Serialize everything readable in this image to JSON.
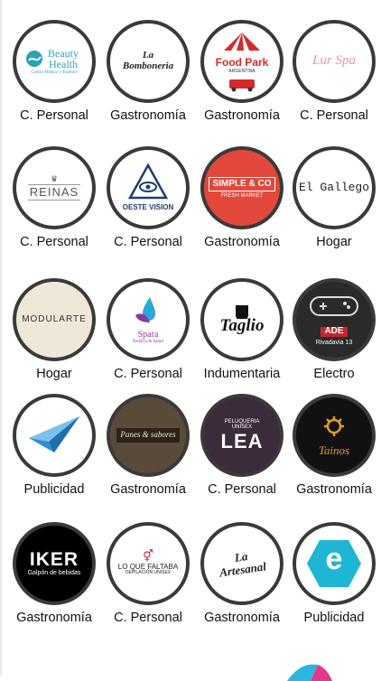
{
  "grid": {
    "rows": [
      [
        {
          "logo_text": "Beauty Health",
          "logo_sub": "Centro Médico y Estético",
          "category": "C. Personal",
          "icon": "beauty-health-logo",
          "accent": "#2aa3b6"
        },
        {
          "logo_text": "La Bomboneria",
          "logo_sub": "",
          "category": "Gastronomía",
          "icon": "la-bomboneria-logo",
          "accent": "#111111"
        },
        {
          "logo_text": "Food Park",
          "logo_sub": "ARGENTINA",
          "category": "Gastronomía",
          "icon": "food-park-logo",
          "accent": "#d42a2a"
        },
        {
          "logo_text": "Lur Spa",
          "logo_sub": "",
          "category": "C. Personal",
          "icon": "lur-spa-logo",
          "accent": "#e693b3"
        }
      ],
      [
        {
          "logo_text": "REINAS",
          "logo_sub": "",
          "category": "C. Personal",
          "icon": "reinas-logo",
          "accent": "#555555"
        },
        {
          "logo_text": "OESTE VISION",
          "logo_sub": "",
          "category": "C. Personal",
          "icon": "oeste-vision-logo",
          "accent": "#1f3f6b"
        },
        {
          "logo_text": "SIMPLE & CO",
          "logo_sub": "FRESH MARKET",
          "category": "Gastronomía",
          "icon": "simple-co-logo",
          "accent": "#e2483c"
        },
        {
          "logo_text": "El Gallego",
          "logo_sub": "",
          "category": "Hogar",
          "icon": "el-gallego-logo",
          "accent": "#222222"
        }
      ],
      [
        {
          "logo_text": "MODULARTE",
          "logo_sub": "",
          "category": "Hogar",
          "icon": "modularte-logo",
          "accent": "#efe7d8"
        },
        {
          "logo_text": "Spara",
          "logo_sub": "Estética & Salud",
          "category": "C. Personal",
          "icon": "spara-logo",
          "accent": "#2aa8d8"
        },
        {
          "logo_text": "Taglio",
          "logo_sub": "",
          "category": "Indumentaria",
          "icon": "taglio-logo",
          "accent": "#111111"
        },
        {
          "logo_text": "ADE",
          "logo_sub": "Rivadavia 13",
          "category": "Electro",
          "icon": "ade-electro-logo",
          "accent": "#2a2a2a"
        }
      ],
      [
        {
          "logo_text": "",
          "logo_sub": "",
          "category": "Publicidad",
          "icon": "paper-plane-logo",
          "accent": "#2b8fd6"
        },
        {
          "logo_text": "Panes & sabores",
          "logo_sub": "",
          "category": "Gastronomía",
          "icon": "panes-sabores-logo",
          "accent": "#5a4a3a"
        },
        {
          "logo_text": "LEA",
          "logo_sub": "PELUQUERIA UNISEX",
          "category": "C. Personal",
          "icon": "lea-logo",
          "accent": "#3b2b3b"
        },
        {
          "logo_text": "Tainos",
          "logo_sub": "",
          "category": "Gastronomía",
          "icon": "tainos-logo",
          "accent": "#e0a020"
        }
      ],
      [
        {
          "logo_text": "IKER",
          "logo_sub": "Galpón de bebidas",
          "category": "Gastronomía",
          "icon": "iker-logo",
          "accent": "#000000"
        },
        {
          "logo_text": "LO QUE FALTABA",
          "logo_sub": "DEPILACIÓN UNISEX",
          "category": "C. Personal",
          "icon": "lo-que-faltaba-logo",
          "accent": "#d4202a"
        },
        {
          "logo_text": "La Artesanal",
          "logo_sub": "",
          "category": "Gastronomía",
          "icon": "la-artesanal-logo",
          "accent": "#111111"
        },
        {
          "logo_text": "e",
          "logo_sub": "",
          "category": "Publicidad",
          "icon": "e-hexagon-logo",
          "accent": "#1fb6d6"
        }
      ]
    ]
  }
}
